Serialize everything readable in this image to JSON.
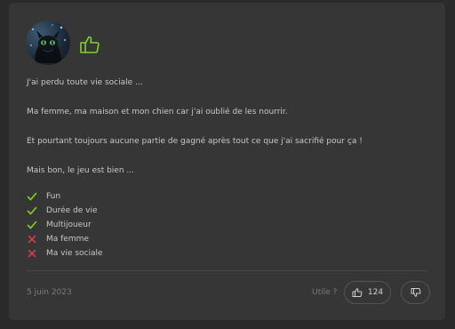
{
  "review": {
    "avatar_icon": "dragon-avatar",
    "rating_icon": "thumbs-up-icon",
    "rating_color": "#7ed321",
    "paragraphs": [
      "J'ai perdu toute vie sociale ...",
      "Ma femme, ma maison et mon chien car j'ai oublié de les nourrir.",
      "Et pourtant toujours aucune partie de gagné après tout ce que j'ai sacrifié pour ça !",
      "Mais bon, le jeu est bien ..."
    ],
    "pros_cons": [
      {
        "label": "Fun",
        "type": "pro",
        "icon": "check-icon"
      },
      {
        "label": "Durée de vie",
        "type": "pro",
        "icon": "check-icon"
      },
      {
        "label": "Multijoueur",
        "type": "pro",
        "icon": "check-icon"
      },
      {
        "label": "Ma femme",
        "type": "con",
        "icon": "cross-icon"
      },
      {
        "label": "Ma vie sociale",
        "type": "con",
        "icon": "cross-icon"
      }
    ],
    "colors": {
      "pro": "#7ed321",
      "con": "#e63c50"
    },
    "date": "5 juin 2023",
    "useful_label": "Utile ?",
    "upvote_count": "124"
  }
}
